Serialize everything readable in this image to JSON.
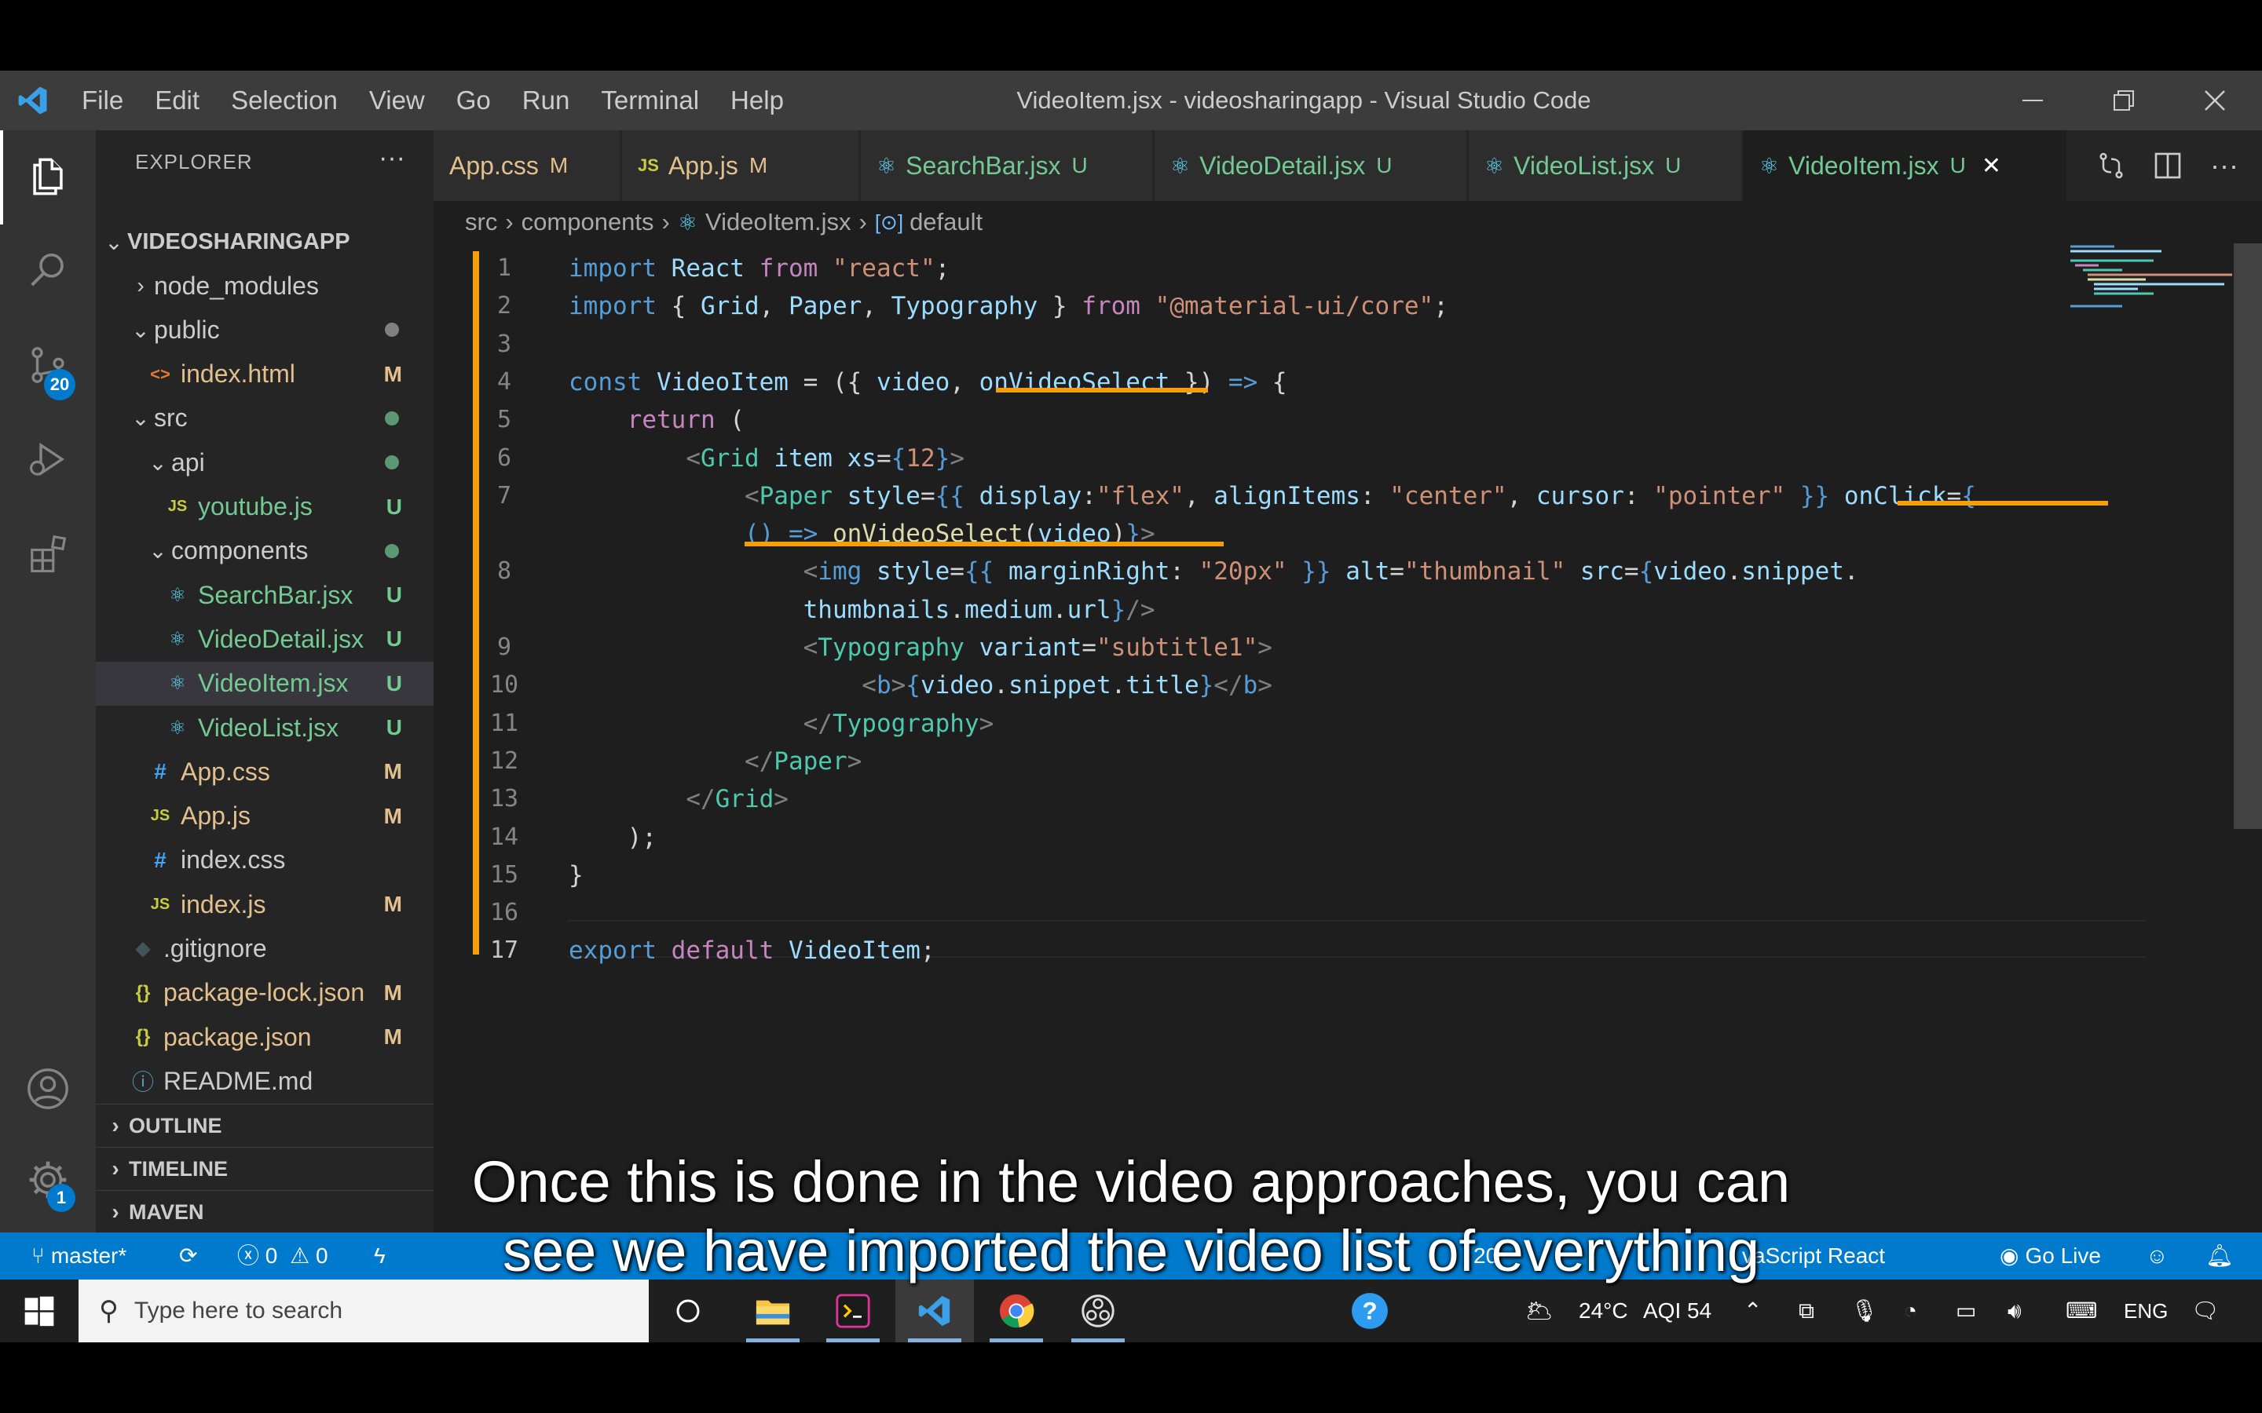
{
  "window": {
    "title": "VideoItem.jsx - videosharingapp - Visual Studio Code",
    "menu": [
      "File",
      "Edit",
      "Selection",
      "View",
      "Go",
      "Run",
      "Terminal",
      "Help"
    ]
  },
  "activity_bar": {
    "source_control_badge": "20",
    "settings_badge": "1"
  },
  "explorer": {
    "header": "EXPLORER",
    "more": "···",
    "root": "VIDEOSHARINGAPP",
    "items": [
      {
        "label": "node_modules",
        "icon": "chevron",
        "status": ""
      },
      {
        "label": "public",
        "icon": "chevron",
        "status": "dot"
      },
      {
        "label": "index.html",
        "icon": "<>",
        "status": "M"
      },
      {
        "label": "src",
        "icon": "chevron",
        "status": "dot"
      },
      {
        "label": "api",
        "icon": "chevron",
        "status": "dot"
      },
      {
        "label": "youtube.js",
        "icon": "JS",
        "status": "U"
      },
      {
        "label": "components",
        "icon": "chevron",
        "status": "dot"
      },
      {
        "label": "SearchBar.jsx",
        "icon": "react",
        "status": "U"
      },
      {
        "label": "VideoDetail.jsx",
        "icon": "react",
        "status": "U"
      },
      {
        "label": "VideoItem.jsx",
        "icon": "react",
        "status": "U"
      },
      {
        "label": "VideoList.jsx",
        "icon": "react",
        "status": "U"
      },
      {
        "label": "App.css",
        "icon": "#",
        "status": "M"
      },
      {
        "label": "App.js",
        "icon": "JS",
        "status": "M"
      },
      {
        "label": "index.css",
        "icon": "#",
        "status": ""
      },
      {
        "label": "index.js",
        "icon": "JS",
        "status": "M"
      },
      {
        "label": ".gitignore",
        "icon": "◆",
        "status": ""
      },
      {
        "label": "package-lock.json",
        "icon": "{}",
        "status": "M"
      },
      {
        "label": "package.json",
        "icon": "{}",
        "status": "M"
      },
      {
        "label": "README.md",
        "icon": "ⓘ",
        "status": ""
      }
    ],
    "panels": [
      "OUTLINE",
      "TIMELINE",
      "MAVEN"
    ]
  },
  "tabs": [
    {
      "label": "App.css",
      "state": "M",
      "icon": ""
    },
    {
      "label": "App.js",
      "state": "M",
      "icon": "JS"
    },
    {
      "label": "SearchBar.jsx",
      "state": "U",
      "icon": "react"
    },
    {
      "label": "VideoDetail.jsx",
      "state": "U",
      "icon": "react"
    },
    {
      "label": "VideoList.jsx",
      "state": "U",
      "icon": "react"
    },
    {
      "label": "VideoItem.jsx",
      "state": "U",
      "icon": "react",
      "close": "✕"
    }
  ],
  "breadcrumb": [
    "src",
    "components",
    "VideoItem.jsx",
    "default"
  ],
  "code": {
    "line_numbers": [
      "1",
      "2",
      "3",
      "4",
      "5",
      "6",
      "7",
      "8",
      "9",
      "10",
      "11",
      "12",
      "13",
      "14",
      "15",
      "16",
      "17"
    ],
    "current_line": "17",
    "lines": [
      [
        [
          "k",
          "import"
        ],
        [
          "p",
          " "
        ],
        [
          "v",
          "React"
        ],
        [
          "p",
          " "
        ],
        [
          "c",
          "from"
        ],
        [
          "p",
          " "
        ],
        [
          "s",
          "\"react\""
        ],
        [
          "p",
          ";"
        ]
      ],
      [
        [
          "k",
          "import"
        ],
        [
          "p",
          " { "
        ],
        [
          "v",
          "Grid"
        ],
        [
          "p",
          ", "
        ],
        [
          "v",
          "Paper"
        ],
        [
          "p",
          ", "
        ],
        [
          "v",
          "Typography"
        ],
        [
          "p",
          " } "
        ],
        [
          "c",
          "from"
        ],
        [
          "p",
          " "
        ],
        [
          "s",
          "\"@material-ui/core\""
        ],
        [
          "p",
          ";"
        ]
      ],
      [],
      [
        [
          "k",
          "const"
        ],
        [
          "p",
          " "
        ],
        [
          "v",
          "VideoItem"
        ],
        [
          "p",
          " = ({ "
        ],
        [
          "v",
          "video"
        ],
        [
          "p",
          ", "
        ],
        [
          "v",
          "onVideoSelect"
        ],
        [
          "p",
          " }) "
        ],
        [
          "k",
          "=>"
        ],
        [
          "p",
          " {"
        ]
      ],
      [
        [
          "p",
          "    "
        ],
        [
          "c",
          "return"
        ],
        [
          "p",
          " ("
        ]
      ],
      [
        [
          "p",
          "        "
        ],
        [
          "g",
          "<"
        ],
        [
          "t",
          "Grid"
        ],
        [
          "p",
          " "
        ],
        [
          "v",
          "item"
        ],
        [
          "p",
          " "
        ],
        [
          "v",
          "xs"
        ],
        [
          "p",
          "="
        ],
        [
          "k",
          "{"
        ],
        [
          "s",
          "12"
        ],
        [
          "k",
          "}"
        ],
        [
          "g",
          ">"
        ]
      ],
      [
        [
          "p",
          "            "
        ],
        [
          "g",
          "<"
        ],
        [
          "t",
          "Paper"
        ],
        [
          "p",
          " "
        ],
        [
          "v",
          "style"
        ],
        [
          "p",
          "="
        ],
        [
          "k",
          "{{"
        ],
        [
          "p",
          " "
        ],
        [
          "v",
          "display"
        ],
        [
          "p",
          ":"
        ],
        [
          "s",
          "\"flex\""
        ],
        [
          "p",
          ", "
        ],
        [
          "v",
          "alignItems"
        ],
        [
          "p",
          ": "
        ],
        [
          "s",
          "\"center\""
        ],
        [
          "p",
          ", "
        ],
        [
          "v",
          "cursor"
        ],
        [
          "p",
          ": "
        ],
        [
          "s",
          "\"pointer\""
        ],
        [
          "p",
          " "
        ],
        [
          "k",
          "}}"
        ],
        [
          "p",
          " "
        ],
        [
          "v",
          "onClick"
        ],
        [
          "p",
          "="
        ],
        [
          "k",
          "{"
        ]
      ],
      [
        [
          "p",
          "            "
        ],
        [
          "k",
          "()"
        ],
        [
          "p",
          " "
        ],
        [
          "k",
          "=>"
        ],
        [
          "p",
          " "
        ],
        [
          "f",
          "onVideoSelect"
        ],
        [
          "p",
          "("
        ],
        [
          "v",
          "video"
        ],
        [
          "p",
          ")"
        ],
        [
          "k",
          "}"
        ],
        [
          "g",
          ">"
        ]
      ],
      [
        [
          "p",
          "                "
        ],
        [
          "g",
          "<"
        ],
        [
          "k",
          "img"
        ],
        [
          "p",
          " "
        ],
        [
          "v",
          "style"
        ],
        [
          "p",
          "="
        ],
        [
          "k",
          "{{"
        ],
        [
          "p",
          " "
        ],
        [
          "v",
          "marginRight"
        ],
        [
          "p",
          ": "
        ],
        [
          "s",
          "\"20px\""
        ],
        [
          "p",
          " "
        ],
        [
          "k",
          "}}"
        ],
        [
          "p",
          " "
        ],
        [
          "v",
          "alt"
        ],
        [
          "p",
          "="
        ],
        [
          "s",
          "\"thumbnail\""
        ],
        [
          "p",
          " "
        ],
        [
          "v",
          "src"
        ],
        [
          "p",
          "="
        ],
        [
          "k",
          "{"
        ],
        [
          "v",
          "video"
        ],
        [
          "p",
          "."
        ],
        [
          "v",
          "snippet"
        ],
        [
          "p",
          "."
        ]
      ],
      [
        [
          "p",
          "                "
        ],
        [
          "v",
          "thumbnails"
        ],
        [
          "p",
          "."
        ],
        [
          "v",
          "medium"
        ],
        [
          "p",
          "."
        ],
        [
          "v",
          "url"
        ],
        [
          "k",
          "}"
        ],
        [
          "g",
          "/>"
        ]
      ],
      [
        [
          "p",
          "                "
        ],
        [
          "g",
          "<"
        ],
        [
          "t",
          "Typography"
        ],
        [
          "p",
          " "
        ],
        [
          "v",
          "variant"
        ],
        [
          "p",
          "="
        ],
        [
          "s",
          "\"subtitle1\""
        ],
        [
          "g",
          ">"
        ]
      ],
      [
        [
          "p",
          "                    "
        ],
        [
          "g",
          "<"
        ],
        [
          "k",
          "b"
        ],
        [
          "g",
          ">"
        ],
        [
          "k",
          "{"
        ],
        [
          "v",
          "video"
        ],
        [
          "p",
          "."
        ],
        [
          "v",
          "snippet"
        ],
        [
          "p",
          "."
        ],
        [
          "v",
          "title"
        ],
        [
          "k",
          "}"
        ],
        [
          "g",
          "</"
        ],
        [
          "k",
          "b"
        ],
        [
          "g",
          ">"
        ]
      ],
      [
        [
          "p",
          "                "
        ],
        [
          "g",
          "</"
        ],
        [
          "t",
          "Typography"
        ],
        [
          "g",
          ">"
        ]
      ],
      [
        [
          "p",
          "            "
        ],
        [
          "g",
          "</"
        ],
        [
          "t",
          "Paper"
        ],
        [
          "g",
          ">"
        ]
      ],
      [
        [
          "p",
          "        "
        ],
        [
          "g",
          "</"
        ],
        [
          "t",
          "Grid"
        ],
        [
          "g",
          ">"
        ]
      ],
      [
        [
          "p",
          "    );"
        ]
      ],
      [
        [
          "p",
          "}"
        ]
      ],
      [],
      [
        [
          "k",
          "export"
        ],
        [
          "p",
          " "
        ],
        [
          "c",
          "default"
        ],
        [
          "p",
          " "
        ],
        [
          "v",
          "VideoItem"
        ],
        [
          "p",
          ";"
        ]
      ]
    ]
  },
  "status_bar": {
    "branch": "master*",
    "errors": "0",
    "warnings": "0",
    "language_partial": "vaScript React",
    "partial_left": "20",
    "go_live": "Go Live"
  },
  "taskbar": {
    "search_placeholder": "Type here to search",
    "weather": "24°C",
    "aqi": "AQI 54",
    "lang": "ENG"
  },
  "caption": {
    "line1": "Once this is done in the video approaches, you can",
    "line2": "see we have imported the video list of everything"
  },
  "colors": {
    "accent": "#007acc",
    "annotation": "#f59e0b",
    "modified": "#e2c08d",
    "untracked": "#73c991"
  }
}
